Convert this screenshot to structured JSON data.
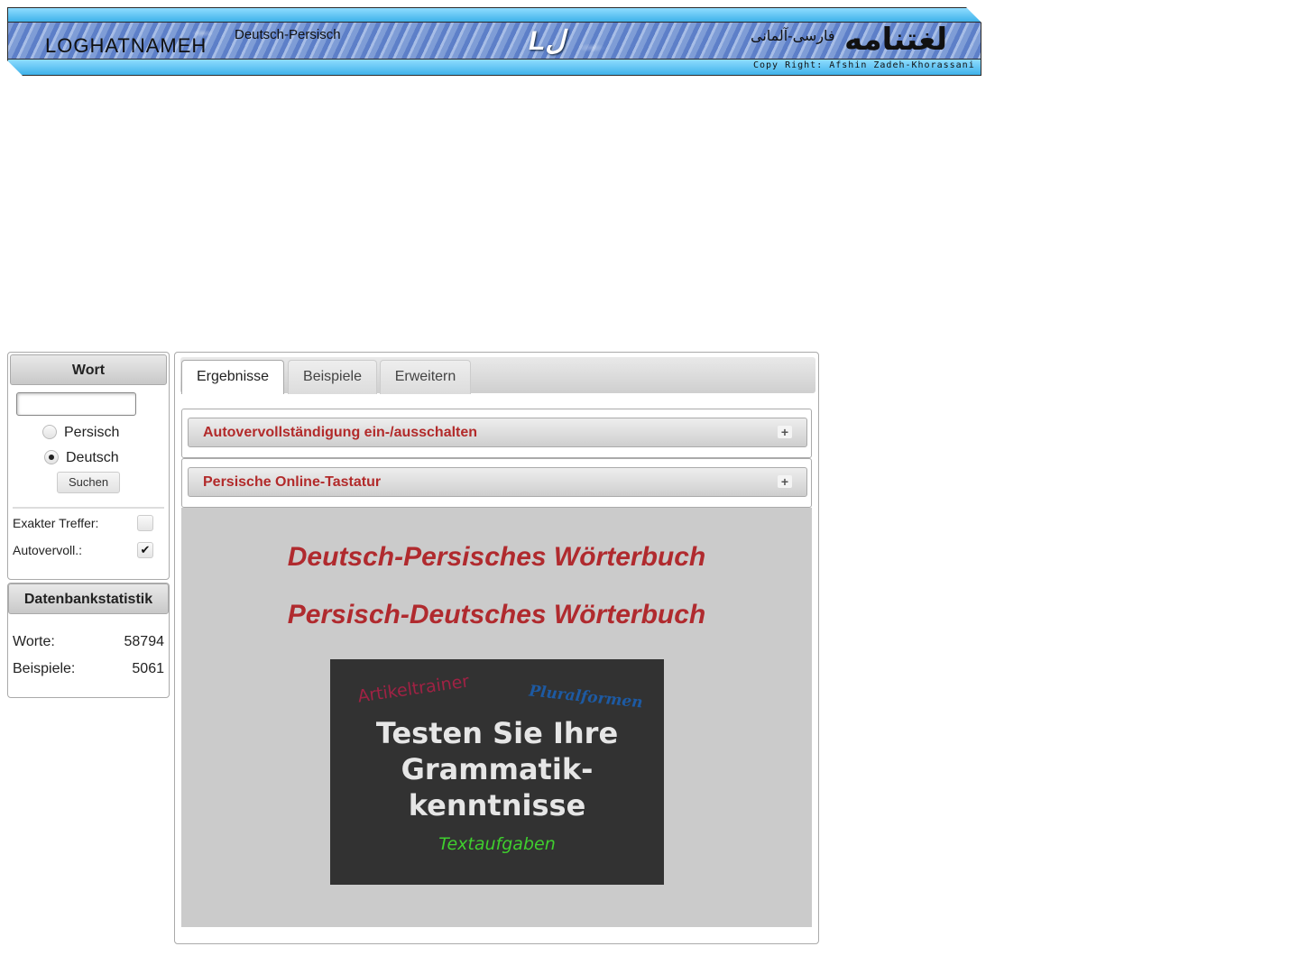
{
  "header": {
    "brand_name": "LOGHATNAMEH",
    "subtitle": "Deutsch-Persisch",
    "logo_text": "Lل",
    "persian_subtitle": "فارسی-آلمانی",
    "persian_title": "لغتنامه",
    "copyright": "Copy Right: Afshin Zadeh-Khorassani"
  },
  "search_panel": {
    "title": "Wort",
    "input_value": "",
    "languages": [
      {
        "label": "Persisch",
        "selected": false
      },
      {
        "label": "Deutsch",
        "selected": true
      }
    ],
    "search_button": "Suchen",
    "options": [
      {
        "label": "Exakter Treffer:",
        "checked": false,
        "mark": ""
      },
      {
        "label": "Autovervoll.:",
        "checked": true,
        "mark": "✔"
      }
    ]
  },
  "stats_panel": {
    "title": "Datenbankstatistik",
    "rows": [
      {
        "label": "Worte:",
        "value": "58794"
      },
      {
        "label": "Beispiele:",
        "value": "5061"
      }
    ]
  },
  "tabs": [
    {
      "label": "Ergebnisse",
      "active": true
    },
    {
      "label": "Beispiele",
      "active": false
    },
    {
      "label": "Erweitern",
      "active": false
    }
  ],
  "accordions": [
    {
      "title": "Autovervollständigung ein-/ausschalten",
      "icon": "+"
    },
    {
      "title": "Persische Online-Tastatur",
      "icon": "+"
    }
  ],
  "content": {
    "title_1": "Deutsch-Persisches Wörterbuch",
    "title_2": "Persisch-Deutsches Wörterbuch",
    "promo": {
      "artikel": "Artikeltrainer",
      "plural": "Pluralformen",
      "line_1": "Testen Sie Ihre",
      "line_2": "Grammatik-",
      "line_3": "kenntnisse",
      "sub": "Textaufgaben"
    }
  },
  "colors": {
    "accent_red": "#b02a2e",
    "banner_blue": "#3fb2ea",
    "promo_green": "#3fcf2e"
  }
}
